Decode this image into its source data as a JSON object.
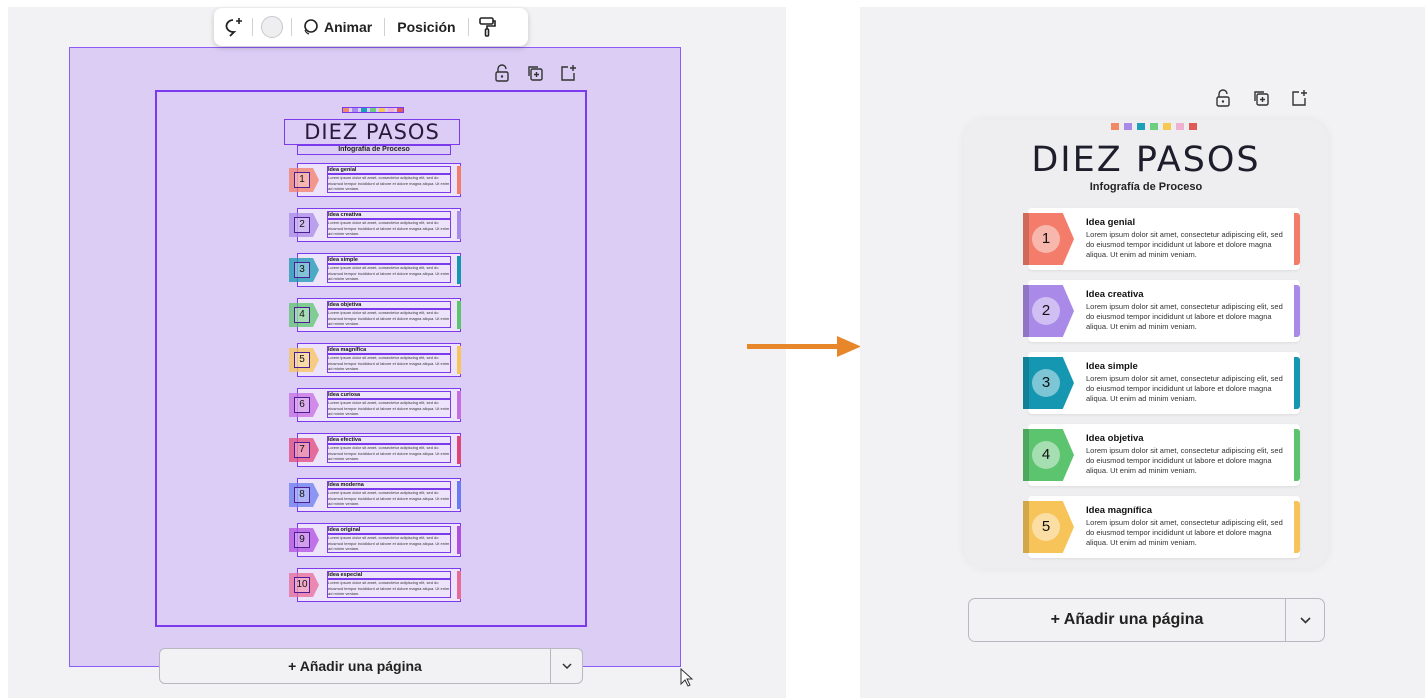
{
  "toolbar": {
    "animate_label": "Animar",
    "position_label": "Posición",
    "color_value": "#eeeef0"
  },
  "infographic": {
    "title": "DIEZ PASOS",
    "subtitle": "Infografía de Proceso",
    "palette": [
      "#f08a66",
      "#a98ae8",
      "#1aa0b8",
      "#6bcf7f",
      "#f5c84f",
      "#f0b0d0",
      "#e05a5a"
    ],
    "body_text": "Lorem ipsum dolor sit amet, consectetur adipiscing elit, sed do eiusmod tempor incididunt ut labore et dolore magna aliqua. Ut enim ad minim veniam."
  },
  "steps_full": [
    {
      "num": "1",
      "title": "Idea genial",
      "color": "#f37d6a"
    },
    {
      "num": "2",
      "title": "Idea creativa",
      "color": "#a98ae8"
    },
    {
      "num": "3",
      "title": "Idea simple",
      "color": "#1597b2"
    },
    {
      "num": "4",
      "title": "Idea objetiva",
      "color": "#5cc46f"
    },
    {
      "num": "5",
      "title": "Idea magnífica",
      "color": "#f7c45a"
    },
    {
      "num": "6",
      "title": "Idea curiosa",
      "color": "#c46ee0"
    },
    {
      "num": "7",
      "title": "Idea efectiva",
      "color": "#e0457a"
    },
    {
      "num": "8",
      "title": "Idea moderna",
      "color": "#6a7cf0"
    },
    {
      "num": "9",
      "title": "Idea original",
      "color": "#b04ee0"
    },
    {
      "num": "10",
      "title": "Idea especial",
      "color": "#e86a9a"
    }
  ],
  "mini_body": "Lorem ipsum dolor sit amet, consectetur adipiscing elit, sed do eiusmod tempor incididunt ut labore et dolore magna aliqua. Ut enim ad minim veniam.",
  "add_page": {
    "label": "+ Añadir una página"
  },
  "icons": {
    "toolbar": [
      "lasso-plus-icon",
      "color-swatch-icon",
      "animate-icon",
      "paint-roller-icon"
    ],
    "frame": [
      "lock-icon",
      "duplicate-icon",
      "add-page-icon"
    ],
    "dropdown": "chevron-down-icon",
    "arrow": "right-arrow-icon",
    "cursor": "mouse-cursor-icon"
  },
  "accent": {
    "selection": "#8b5cf6",
    "arrow": "#e8862a"
  }
}
